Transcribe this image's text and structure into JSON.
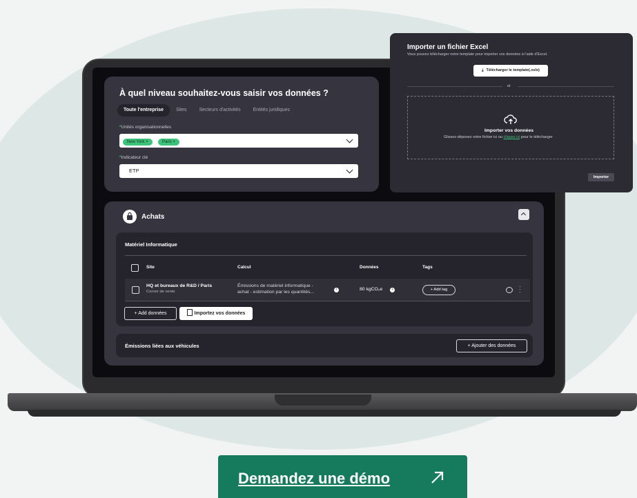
{
  "level_card": {
    "title": "À quel niveau souhaitez-vous saisir vos données ?",
    "tabs": [
      "Toute l'entreprise",
      "Sites",
      "Secteurs d'activités",
      "Entités juridiques"
    ],
    "units_label": "Unités organisationnelles",
    "units_chips": [
      "New York",
      "Paris"
    ],
    "indicator_label": "Indicateur clé",
    "indicator_value": "ETP"
  },
  "achats": {
    "title": "Achats",
    "section_title": "Matériel Informatique",
    "columns": [
      "Site",
      "Calcul",
      "Données",
      "Tags"
    ],
    "row": {
      "site": "HQ et bureaux de R&D / Paris",
      "site_sub": "Corner de vente",
      "calc_line1": "Émissions de matériel informatique -",
      "calc_line2": "achat - estimation par les quantités...",
      "value": "80 kgCO₂e",
      "tag_button": "Add tag"
    },
    "add_button": "Add données",
    "import_button": "Importez vos données"
  },
  "vehicles": {
    "title": "Émissions liées aux véhicules",
    "add_button": "Ajouter des données"
  },
  "modal": {
    "title": "Importer un fichier Excel",
    "subtitle": "Vous pouvez télécharger notre template pour importer vos données à l'aide d'Excel.",
    "download_button": "Télécharger le template(.xslx)",
    "divider": "et",
    "drop_title": "Importer vos données",
    "drop_text_before": "Glissez-déposez votre fichier ici ou ",
    "drop_link": "cliquez ici",
    "drop_text_after": " pour le télécharger",
    "import_button": "Importer"
  },
  "cta": {
    "label": "Demandez une démo"
  },
  "colors": {
    "accent": "#3cc27a",
    "cta_bg": "#167a5d",
    "card": "#36353f",
    "panel": "#25242c"
  }
}
